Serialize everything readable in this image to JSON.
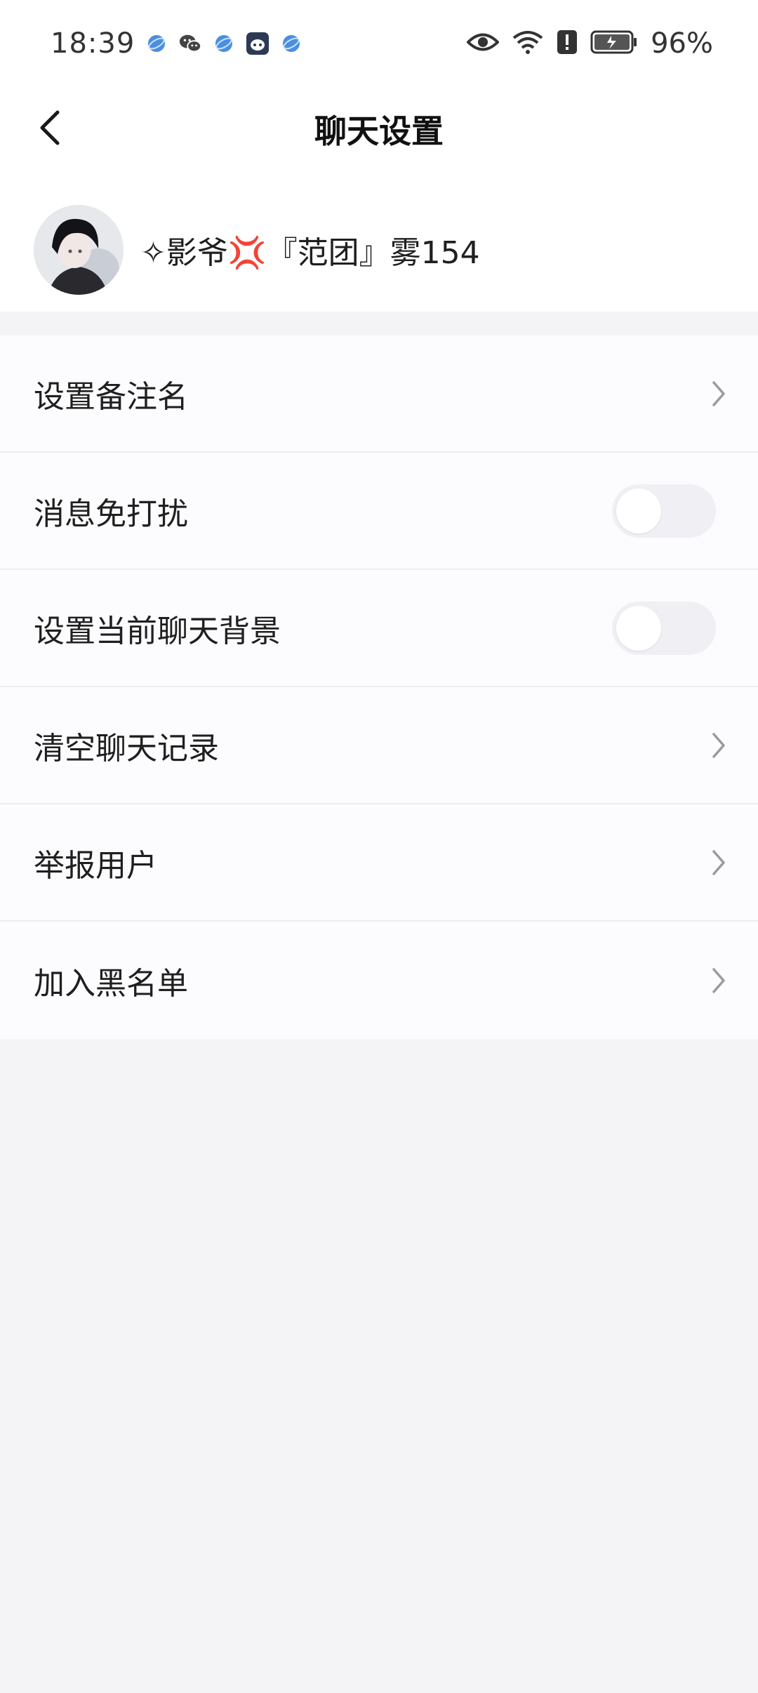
{
  "status_bar": {
    "time": "18:39",
    "battery": "96%",
    "notification_icons": [
      "browser-icon",
      "wechat-icon",
      "browser-icon",
      "bot-app-icon",
      "browser-icon"
    ],
    "system_icons": [
      "eye-icon",
      "wifi-icon",
      "alert-icon",
      "battery-icon"
    ]
  },
  "header": {
    "title": "聊天设置",
    "back_icon": "chevron-left-icon"
  },
  "profile": {
    "name": "✧影爷💢『范团』雾154"
  },
  "menu": {
    "items": [
      {
        "label": "设置备注名",
        "control": "chevron"
      },
      {
        "label": "消息免打扰",
        "control": "toggle",
        "on": false
      },
      {
        "label": "设置当前聊天背景",
        "control": "toggle",
        "on": false
      },
      {
        "label": "清空聊天记录",
        "control": "chevron"
      },
      {
        "label": "举报用户",
        "control": "chevron"
      },
      {
        "label": "加入黑名单",
        "control": "chevron"
      }
    ]
  },
  "colors": {
    "background": "#f4f3f6",
    "card": "#ffffff",
    "toggle_off": "#f0eff3",
    "chevron": "#9a9a9f"
  }
}
